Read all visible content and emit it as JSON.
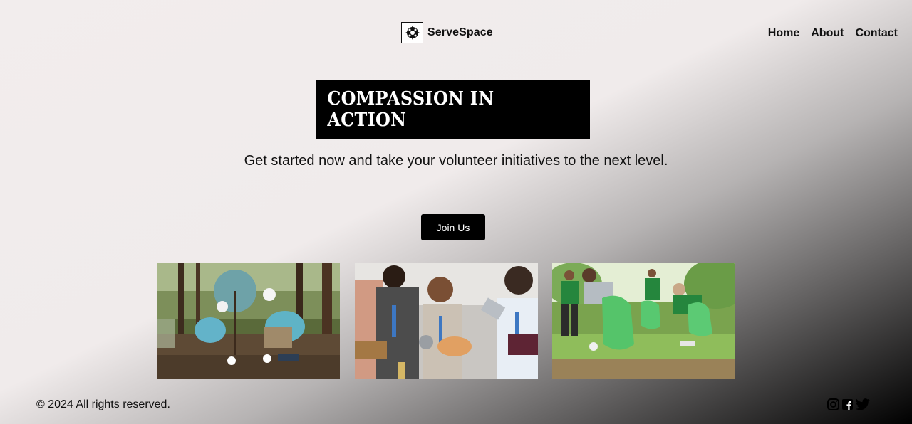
{
  "header": {
    "brand": "ServeSpace",
    "nav": [
      "Home",
      "About",
      "Contact"
    ]
  },
  "hero": {
    "title": "COMPASSION IN ACTION",
    "subtitle": "Get started now and take your volunteer initiatives to the next level.",
    "cta": "Join Us"
  },
  "gallery": [
    {
      "icon": "volunteers-planting-tree-photo"
    },
    {
      "icon": "food-drive-volunteers-photo"
    },
    {
      "icon": "park-cleanup-volunteers-photo"
    }
  ],
  "footer": {
    "copyright": "© 2024 All rights reserved.",
    "social": [
      "instagram-icon",
      "facebook-icon",
      "twitter-icon"
    ]
  },
  "colors": {
    "accent": "#000000",
    "background_light": "#f2eded",
    "background_dark": "#000000"
  }
}
